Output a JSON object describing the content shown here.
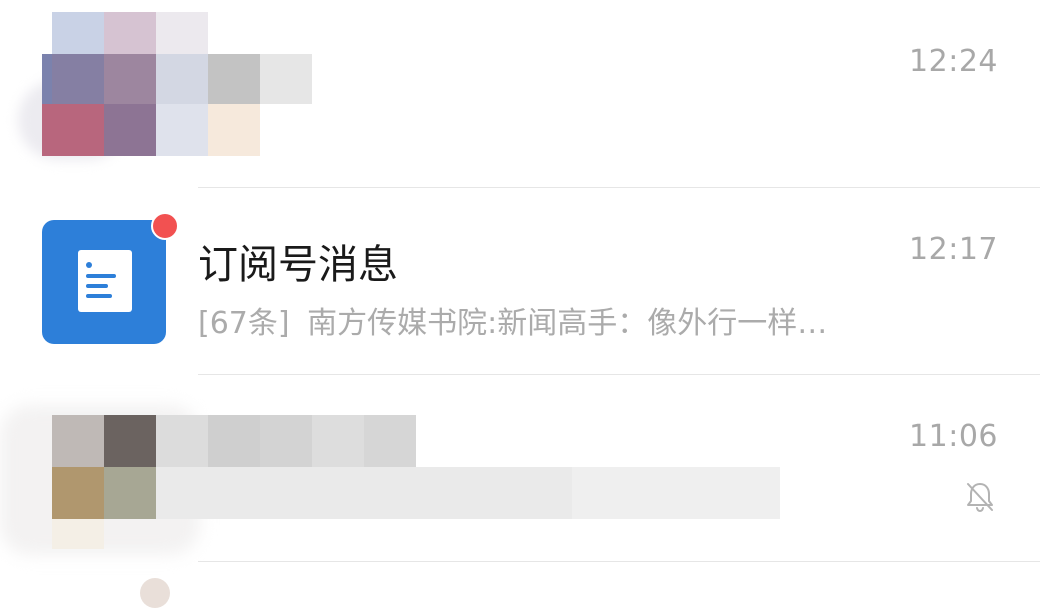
{
  "chat_list": {
    "rows": [
      {
        "time": "12:24"
      },
      {
        "title": "订阅号消息",
        "count": "[67条]",
        "preview": "南方传媒书院:新闻高手：像外行一样…",
        "time": "12:17"
      },
      {
        "time": "11:06",
        "muted": true
      }
    ]
  },
  "colors": {
    "subscription_avatar": "#2d7fd9",
    "badge": "#f25151",
    "time_text": "#a8a8a8",
    "preview_text": "#ababab",
    "title_text": "#1a1a1a",
    "divider": "#e6e6e6"
  },
  "icons": {
    "subscription": "document-icon",
    "mute": "bell-off-icon",
    "unread": "unread-dot"
  }
}
